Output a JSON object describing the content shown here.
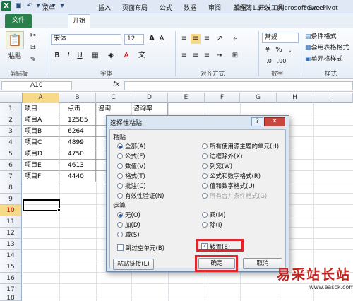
{
  "window": {
    "title": "工作簿1.xlsx - Microsoft Excel"
  },
  "ribbon": {
    "tabs": [
      "文件",
      "菜单",
      "开始",
      "插入",
      "页面布局",
      "公式",
      "数据",
      "审阅",
      "视图",
      "开发工具",
      "PowerPivot"
    ],
    "font_name": "宋体",
    "font_size": "12",
    "number_format": "常规",
    "paste_label": "粘贴",
    "groups": {
      "clipboard": "剪贴板",
      "font": "字体",
      "alignment": "对齐方式",
      "number": "数字",
      "styles": "样式"
    },
    "styles_items": [
      "条件格式",
      "套用表格格式",
      "单元格样式"
    ]
  },
  "formula_bar": {
    "name_box": "A10",
    "fx": "fx"
  },
  "sheet": {
    "columns": [
      "A",
      "B",
      "C",
      "D",
      "E",
      "F",
      "G",
      "H",
      "I"
    ],
    "rows": [
      "1",
      "2",
      "3",
      "4",
      "5",
      "6",
      "7",
      "8",
      "9",
      "10",
      "11",
      "12",
      "13",
      "14",
      "15",
      "16",
      "17",
      "18"
    ],
    "headers": [
      "项目",
      "点击",
      "咨询",
      "咨询率"
    ],
    "data": [
      [
        "项目A",
        "12585"
      ],
      [
        "项目B",
        "6264"
      ],
      [
        "项目C",
        "4899"
      ],
      [
        "项目D",
        "4750"
      ],
      [
        "项目E",
        "4613"
      ],
      [
        "项目F",
        "4440"
      ]
    ]
  },
  "dialog": {
    "title": "选择性粘贴",
    "help": "?",
    "close": "✕",
    "paste_section": "粘贴",
    "paste_left": [
      "全部(A)",
      "公式(F)",
      "数值(V)",
      "格式(T)",
      "批注(C)",
      "有效性验证(N)"
    ],
    "paste_right": [
      "所有使用源主题的单元(H)",
      "边框除外(X)",
      "列宽(W)",
      "公式和数字格式(R)",
      "值和数字格式(U)",
      "所有合并条件格式(G)"
    ],
    "operation_section": "运算",
    "op_left": [
      "无(O)",
      "加(D)",
      "减(S)"
    ],
    "op_right": [
      "乘(M)",
      "除(I)"
    ],
    "skip_blanks": "跳过空单元(B)",
    "transpose": "转置(E)",
    "paste_link": "粘贴链接(L)",
    "ok": "确定",
    "cancel": "取消"
  },
  "watermark": {
    "text": "易采站长站",
    "url": "www.easck.com"
  }
}
